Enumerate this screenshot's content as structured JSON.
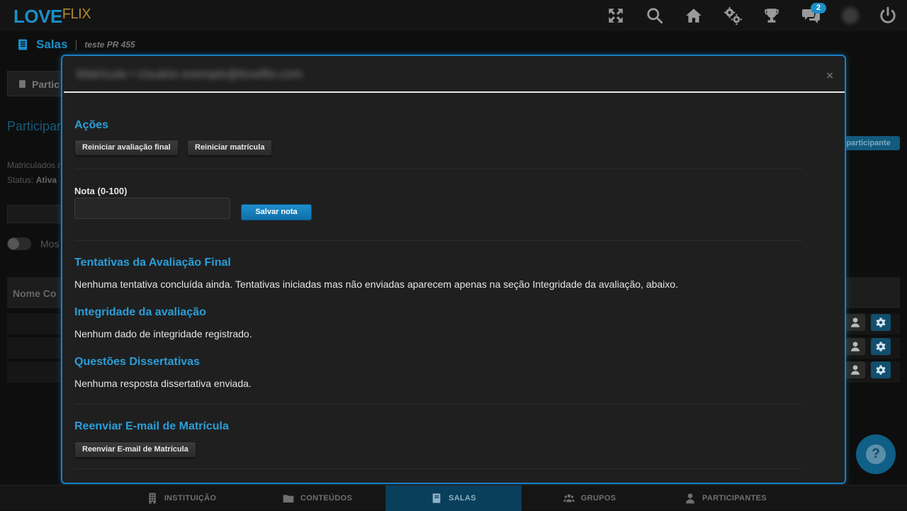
{
  "app": {
    "logo_love": "LOVE",
    "logo_flix": "FLIX",
    "notification_count": "2"
  },
  "top_icons": [
    "fullscreen-icon",
    "search-icon",
    "home-icon",
    "settings-gears-icon",
    "trophy-icon",
    "chat-icon",
    "avatar",
    "power-icon"
  ],
  "breadcrumb": {
    "title": "Salas",
    "separator": "|",
    "subtitle": "teste PR 455"
  },
  "background": {
    "tab_label": "Partic",
    "section_title": "Participan",
    "enrolled_label": "Matriculados n",
    "status_label": "Status:",
    "status_value": "Ativa",
    "toggle_label": "Mos",
    "table_header": "Nome Co",
    "add_button": "r participante"
  },
  "modal": {
    "title": "Matrícula • Usuário exemplo@loveflix.com",
    "close": "×",
    "actions": {
      "title": "Ações",
      "reset_final_label": "Reiniciar avaliação final",
      "reset_enrollment_label": "Reiniciar matrícula"
    },
    "grade": {
      "label": "Nota (0-100)",
      "value": "",
      "placeholder": "",
      "save_label": "Salvar nota"
    },
    "attempts": {
      "title": "Tentativas da Avaliação Final",
      "text": "Nenhuma tentativa concluída ainda. Tentativas iniciadas mas não enviadas aparecem apenas na seção Integridade da avaliação, abaixo."
    },
    "integrity": {
      "title": "Integridade da avaliação",
      "text": "Nenhum dado de integridade registrado."
    },
    "essays": {
      "title": "Questões Dissertativas",
      "text": "Nenhuma resposta dissertativa enviada."
    },
    "resend": {
      "title": "Reenviar E-mail de Matrícula",
      "button_label": "Reenviar E-mail de Matrícula"
    }
  },
  "help": {
    "label": "?"
  },
  "bottom_nav": [
    {
      "label": "INSTITUIÇÃO",
      "icon": "building-icon",
      "active": false
    },
    {
      "label": "CONTEÚDOS",
      "icon": "folder-icon",
      "active": false
    },
    {
      "label": "SALAS",
      "icon": "book-icon",
      "active": true
    },
    {
      "label": "GRUPOS",
      "icon": "group-icon",
      "active": false
    },
    {
      "label": "PARTICIPANTES",
      "icon": "user-icon",
      "active": false
    }
  ],
  "colors": {
    "accent": "#1a8fc9",
    "modal_border": "#1a7fc4",
    "section_title": "#2a9ed8",
    "logo_flix": "#b08a2e"
  }
}
